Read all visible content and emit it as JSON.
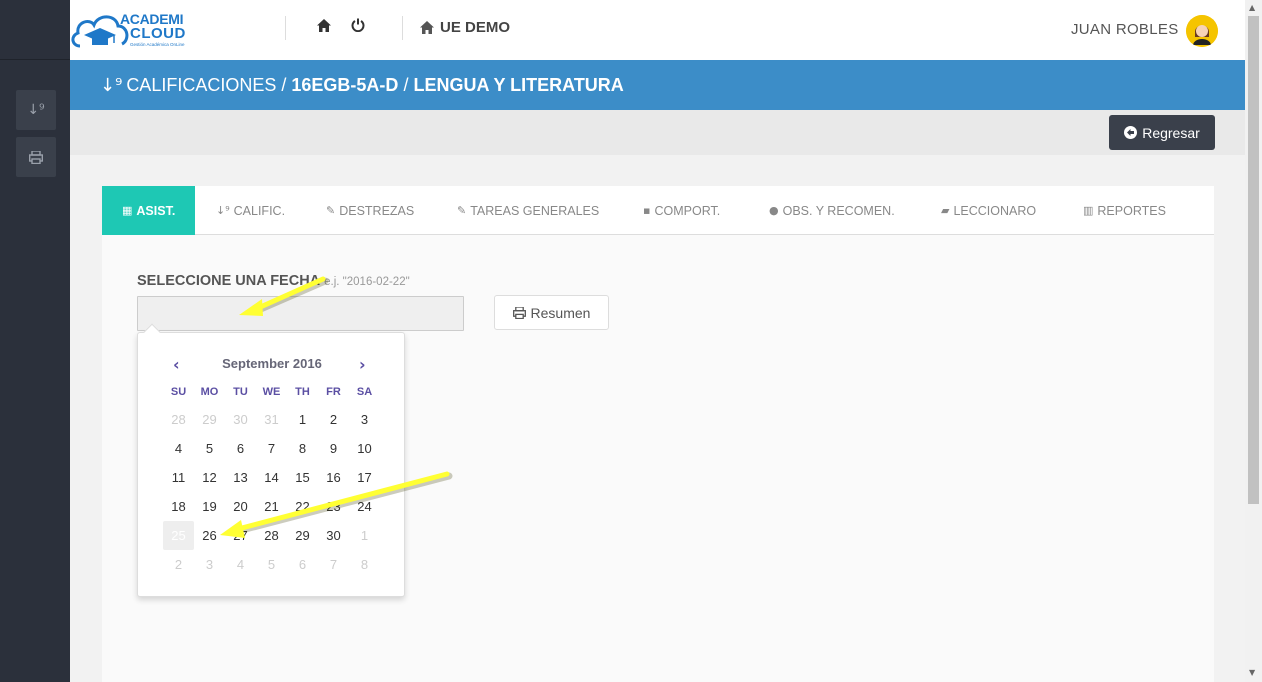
{
  "header": {
    "logo_line1": "ACADEMI",
    "logo_line2": "CLOUD",
    "logo_sub": "Gestión Académica OnLine",
    "school_name": "UE DEMO",
    "user_name": "JUAN ROBLES"
  },
  "title": {
    "section": "CALIFICACIONES",
    "sep1": "/",
    "course": "16EGB-5A-D",
    "sep2": "/",
    "subject": "LENGUA Y LITERATURA"
  },
  "actions": {
    "back_label": "Regresar"
  },
  "tabs": [
    {
      "label": "ASIST.",
      "icon": "calendar-icon"
    },
    {
      "label": "CALIFIC.",
      "icon": "sort-numeric-icon"
    },
    {
      "label": "DESTREZAS",
      "icon": "edit-icon"
    },
    {
      "label": "TAREAS GENERALES",
      "icon": "edit-icon"
    },
    {
      "label": "COMPORT.",
      "icon": "comment-box-icon"
    },
    {
      "label": "OBS. Y RECOMEN.",
      "icon": "comments-icon"
    },
    {
      "label": "LECCIONARO",
      "icon": "book-icon"
    },
    {
      "label": "REPORTES",
      "icon": "bar-chart-icon"
    }
  ],
  "form": {
    "date_label": "SELECCIONE UNA FECHA",
    "date_hint": "e.j. \"2016-02-22\"",
    "date_value": "",
    "summary_label": "Resumen"
  },
  "datepicker": {
    "month_title": "September 2016",
    "prev": "‹",
    "next": "›",
    "dows": [
      "SU",
      "MO",
      "TU",
      "WE",
      "TH",
      "FR",
      "SA"
    ],
    "weeks": [
      [
        "28",
        "29",
        "30",
        "31",
        "1",
        "2",
        "3"
      ],
      [
        "4",
        "5",
        "6",
        "7",
        "8",
        "9",
        "10"
      ],
      [
        "11",
        "12",
        "13",
        "14",
        "15",
        "16",
        "17"
      ],
      [
        "18",
        "19",
        "20",
        "21",
        "22",
        "23",
        "24"
      ],
      [
        "25",
        "26",
        "27",
        "28",
        "29",
        "30",
        "1"
      ],
      [
        "2",
        "3",
        "4",
        "5",
        "6",
        "7",
        "8"
      ]
    ],
    "today": "25",
    "accent_color": "#5b4fa3"
  },
  "colors": {
    "title_bar": "#3c8dc8",
    "active_tab": "#1ec8b4",
    "sidebar": "#2b303b",
    "arrow": "#ffff33"
  }
}
